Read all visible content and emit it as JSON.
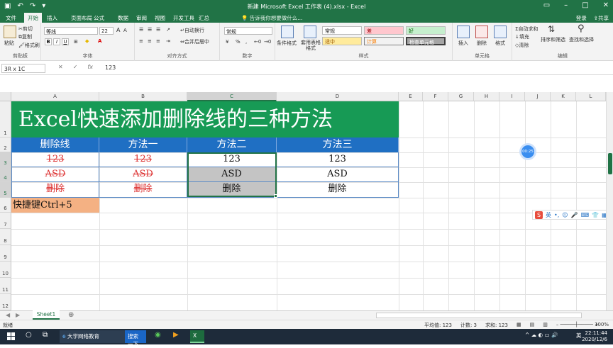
{
  "titlebar": {
    "title": "新建 Microsoft Excel 工作表 (4).xlsx - Excel",
    "login": "登录",
    "share": "共享"
  },
  "tabs": [
    "文件",
    "开始",
    "插入",
    "页面布局",
    "公式",
    "数据",
    "审阅",
    "视图",
    "开发工具",
    "汇总"
  ],
  "tellme": "告诉我你想要做什么...",
  "ribbon": {
    "clipboard": {
      "label": "剪贴板",
      "paste": "粘贴",
      "cut": "剪切",
      "copy": "复制",
      "painter": "格式刷"
    },
    "font": {
      "label": "字体",
      "name": "等线",
      "size": "22",
      "bold": "B",
      "italic": "I",
      "underline": "U"
    },
    "alignment": {
      "label": "对齐方式",
      "wrap": "自动换行",
      "merge": "合并后居中"
    },
    "number": {
      "label": "数字",
      "format": "常规",
      "percent": "%"
    },
    "styles": {
      "label": "样式",
      "cond": "条件格式",
      "table": "套用表格格式",
      "normal": "常规",
      "bad": "差",
      "good": "好",
      "neutral": "适中",
      "calc": "计算",
      "check": "检查单元格"
    },
    "cells": {
      "label": "单元格",
      "insert": "插入",
      "delete": "删除",
      "format": "格式"
    },
    "editing": {
      "label": "编辑",
      "autosum": "自动求和",
      "fill": "填充",
      "clear": "清除",
      "sort": "排序和筛选",
      "find": "查找和选择"
    }
  },
  "formula": {
    "namebox": "3R x 1C",
    "fx": "fx",
    "value": "123"
  },
  "columns": [
    "A",
    "B",
    "C",
    "D",
    "E",
    "F",
    "G",
    "H",
    "I",
    "J",
    "K",
    "L"
  ],
  "rows": [
    "1",
    "2",
    "3",
    "4",
    "5",
    "6",
    "7",
    "8",
    "9",
    "10",
    "11",
    "12"
  ],
  "sheet": {
    "title": "Excel快速添加删除线的三种方法",
    "headers": [
      "删除线",
      "方法一",
      "方法二",
      "方法三"
    ],
    "data": [
      [
        "123",
        "123",
        "123",
        "123"
      ],
      [
        "ASD",
        "ASD",
        "ASD",
        "ASD"
      ],
      [
        "删除",
        "删除",
        "删除",
        "删除"
      ]
    ],
    "shortcut": "快捷键Ctrl+5"
  },
  "bubble": "00:25",
  "ime": {
    "lang": "英"
  },
  "sheettabs": [
    "Sheet1"
  ],
  "status": {
    "ready": "就绪",
    "average": "平均值: 123",
    "count": "计数: 3",
    "sum": "求和: 123",
    "zoom": "100%"
  },
  "taskbar": {
    "browser": "大学网络教育",
    "search": "搜索一下",
    "time": "22:11:44",
    "date": "2020/12/6",
    "lang": "英"
  },
  "colors": {
    "excel_green": "#217346",
    "title_green": "#179a55",
    "header_blue": "#1f6fc3",
    "shortcut_orange": "#f4b183",
    "strike_red": "#d33333"
  }
}
